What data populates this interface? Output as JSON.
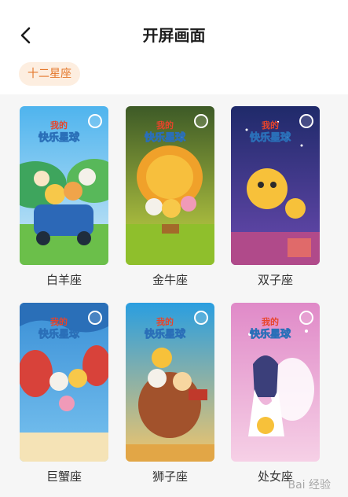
{
  "header": {
    "title": "开屏画面"
  },
  "filter": {
    "chip_label": "十二星座"
  },
  "cards": [
    {
      "caption": "白羊座"
    },
    {
      "caption": "金牛座"
    },
    {
      "caption": "双子座"
    },
    {
      "caption": "巨蟹座"
    },
    {
      "caption": "狮子座"
    },
    {
      "caption": "处女座"
    }
  ],
  "artwork_logo": {
    "line1": "我的",
    "line2": "快乐星球"
  },
  "watermark": {
    "text": "Bai 经验"
  },
  "colors": {
    "accent_text": "#e4782c",
    "chip_bg": "#fdeee0",
    "grid_bg": "#f6f6f6"
  }
}
